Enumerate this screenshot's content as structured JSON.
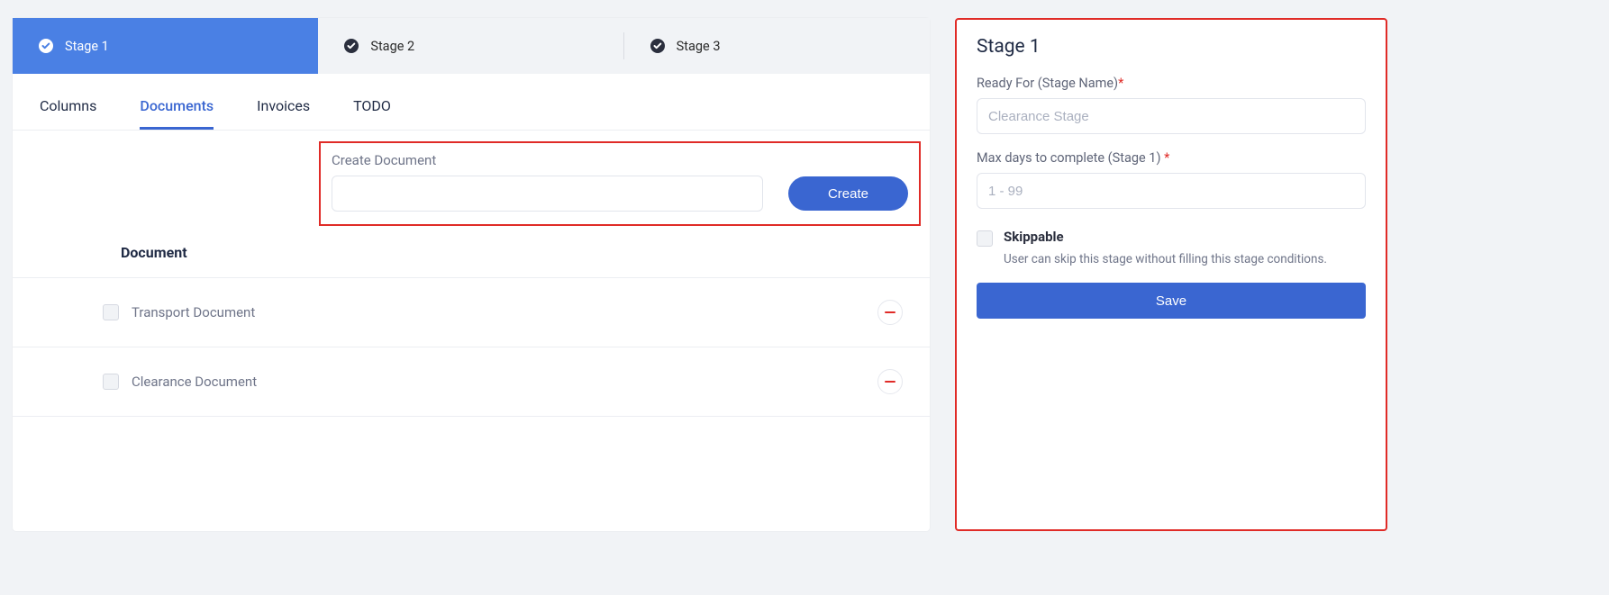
{
  "stages": [
    {
      "label": "Stage 1",
      "active": true
    },
    {
      "label": "Stage 2",
      "active": false
    },
    {
      "label": "Stage 3",
      "active": false
    }
  ],
  "content_tabs": [
    {
      "label": "Columns",
      "active": false
    },
    {
      "label": "Documents",
      "active": true
    },
    {
      "label": "Invoices",
      "active": false
    },
    {
      "label": "TODO",
      "active": false
    }
  ],
  "create": {
    "label": "Create Document",
    "value": "",
    "button": "Create"
  },
  "doc_header": "Document",
  "documents": [
    {
      "name": "Transport Document"
    },
    {
      "name": "Clearance Document"
    }
  ],
  "side": {
    "title": "Stage 1",
    "stage_name_label": "Ready For (Stage Name)",
    "stage_name_placeholder": "Clearance Stage",
    "max_days_label": "Max days to complete (Stage 1) ",
    "max_days_placeholder": "1 - 99",
    "skippable_label": "Skippable",
    "skippable_desc": "User can skip this stage without filling this stage conditions.",
    "save": "Save",
    "required_mark": "*"
  }
}
